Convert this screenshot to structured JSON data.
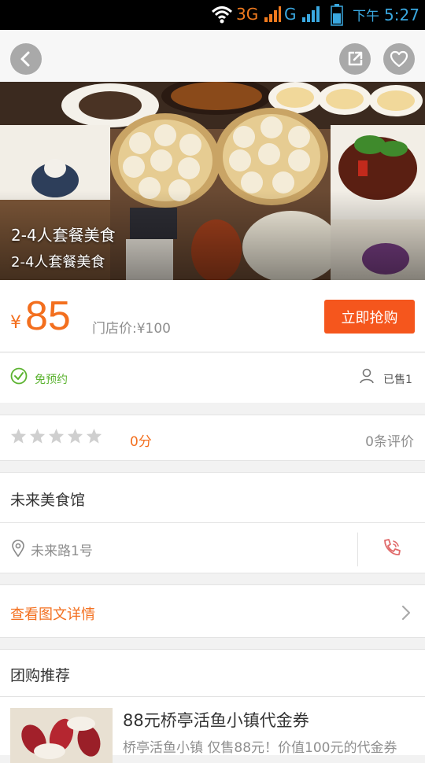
{
  "status_bar": {
    "network": "3G",
    "network2": "G",
    "ampm": "下午",
    "time": "5:27",
    "icons": [
      "wifi-icon",
      "signal-icon",
      "signal-icon",
      "battery-icon"
    ]
  },
  "nav": {
    "icons": [
      "back-arrow-icon",
      "share-icon",
      "heart-icon"
    ]
  },
  "hero": {
    "title": "2-4人套餐美食",
    "subtitle": "2-4人套餐美食"
  },
  "price": {
    "currency": "¥",
    "value": "85",
    "original": "门店价:¥100",
    "buy_label": "立即抢购",
    "accent": "#f36f1e",
    "button_color": "#f5561d"
  },
  "tags": {
    "no_reservation": "免预约",
    "sold": "已售1",
    "green": "#5cb331"
  },
  "rating": {
    "stars_filled": 0,
    "stars_total": 5,
    "score": "0分",
    "reviews": "0条评价"
  },
  "shop": {
    "name": "未来美食馆",
    "address": "未来路1号"
  },
  "detail": {
    "label": "查看图文详情"
  },
  "recommend": {
    "heading": "团购推荐",
    "items": [
      {
        "title": "88元桥亭活鱼小镇代金券",
        "desc": "桥亭活鱼小镇 仅售88元！价值100元的代金券"
      }
    ]
  }
}
